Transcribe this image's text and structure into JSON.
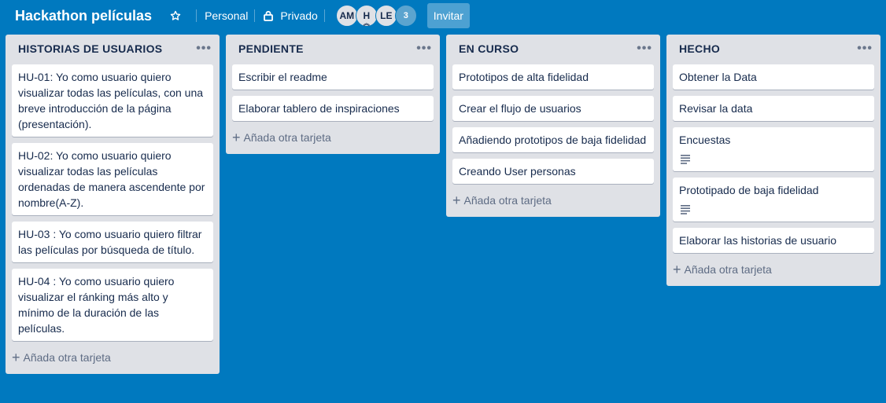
{
  "board": {
    "title": "Hackathon películas",
    "team": "Personal",
    "visibility": "Privado",
    "invite_label": "Invitar",
    "members": [
      "AM",
      "H",
      "LE"
    ],
    "member_overflow": "3",
    "background_color": "#0079bf"
  },
  "add_card_label": "Añada otra tarjeta",
  "list_menu_glyph": "•••",
  "lists": [
    {
      "title": "HISTORIAS DE USUARIOS",
      "cards": [
        {
          "text": "HU-01: Yo como usuario quiero visualizar todas las películas, con una breve introducción de la página (presentación)."
        },
        {
          "text": "HU-02: Yo como usuario quiero visualizar todas las películas ordenadas de manera ascendente por nombre(A-Z)."
        },
        {
          "text": "HU-03 : Yo como usuario quiero filtrar las películas por búsqueda de título."
        },
        {
          "text": "HU-04 : Yo como usuario quiero visualizar el ránking más alto y mínimo de la duración de las películas."
        }
      ]
    },
    {
      "title": "PENDIENTE",
      "cards": [
        {
          "text": "Escribir el readme"
        },
        {
          "text": "Elaborar tablero de inspiraciones"
        }
      ]
    },
    {
      "title": "EN CURSO",
      "cards": [
        {
          "text": "Prototipos de alta fidelidad"
        },
        {
          "text": "Crear el flujo de usuarios"
        },
        {
          "text": "Añadiendo prototipos de baja fidelidad"
        },
        {
          "text": "Creando User personas"
        }
      ]
    },
    {
      "title": "HECHO",
      "cards": [
        {
          "text": "Obtener la Data"
        },
        {
          "text": "Revisar la data"
        },
        {
          "text": "Encuestas",
          "has_description": true
        },
        {
          "text": "Prototipado de baja fidelidad",
          "has_description": true
        },
        {
          "text": "Elaborar las historias de usuario"
        }
      ]
    }
  ]
}
